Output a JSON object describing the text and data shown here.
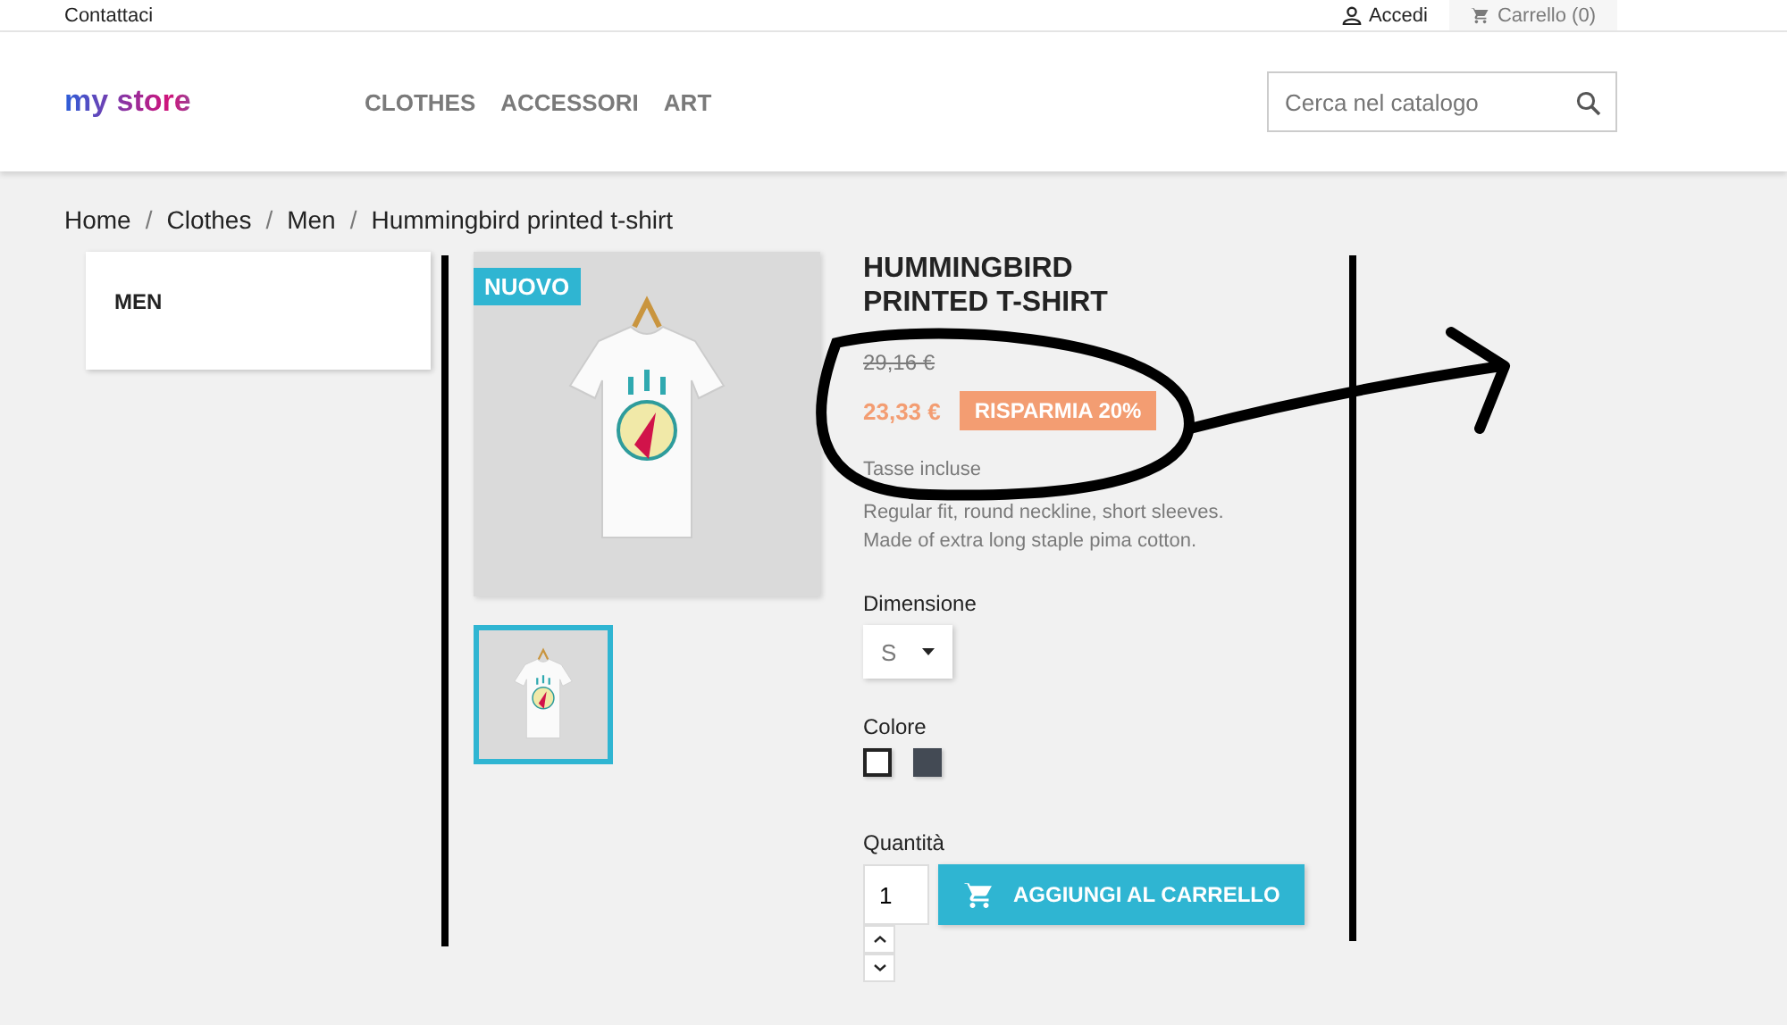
{
  "top_bar": {
    "contact": "Contattaci",
    "login": "Accedi",
    "cart": "Carrello (0)"
  },
  "header": {
    "logo": "my store",
    "nav": [
      "CLOTHES",
      "ACCESSORI",
      "ART"
    ],
    "search": {
      "placeholder": "Cerca nel catalogo"
    }
  },
  "breadcrumb": {
    "separator": "/",
    "items": [
      "Home",
      "Clothes",
      "Men",
      "Hummingbird printed t-shirt"
    ]
  },
  "sidebar": {
    "title": "MEN"
  },
  "product": {
    "badge": "NUOVO",
    "thumbnails": [
      {
        "selected": true
      }
    ],
    "title": "HUMMINGBIRD PRINTED T-SHIRT",
    "old_price": "29,16 €",
    "price": "23,33 €",
    "discount": "RISPARMIA 20%",
    "tax_note": "Tasse incluse",
    "description": [
      "Regular fit, round neckline, short sleeves.",
      "Made of extra long staple pima cotton."
    ],
    "size": {
      "label": "Dimensione",
      "value": "S"
    },
    "color": {
      "label": "Colore",
      "swatches": [
        {
          "color": "#ffffff",
          "selected": true
        },
        {
          "color": "#434a54",
          "selected": false
        }
      ]
    },
    "quantity": {
      "label": "Quantità",
      "value": "1"
    },
    "add_to_cart": "AGGIUNGI AL CARRELLO"
  }
}
